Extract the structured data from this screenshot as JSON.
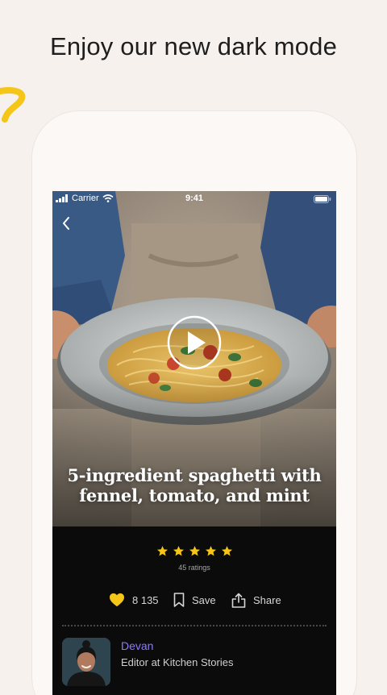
{
  "headline": "Enjoy our new dark mode",
  "status_bar": {
    "carrier": "Carrier",
    "time": "9:41"
  },
  "recipe": {
    "title_line1": "5-ingredient spaghetti with",
    "title_line2": "fennel, tomato, and mint"
  },
  "rating": {
    "stars_filled": 5,
    "stars_total": 5,
    "ratings_text": "45 ratings"
  },
  "actions": {
    "likes": "8 135",
    "save_label": "Save",
    "share_label": "Share"
  },
  "author": {
    "name": "Devan",
    "role": "Editor at Kitchen Stories"
  },
  "colors": {
    "page_background": "#F6F1EC",
    "screen_background": "#0B0B0B",
    "accent_yellow": "#F5C518",
    "author_link": "#8B7CF6"
  },
  "icons": [
    "back-arrow",
    "play",
    "star",
    "heart",
    "bookmark",
    "share",
    "wifi",
    "signal",
    "battery"
  ]
}
